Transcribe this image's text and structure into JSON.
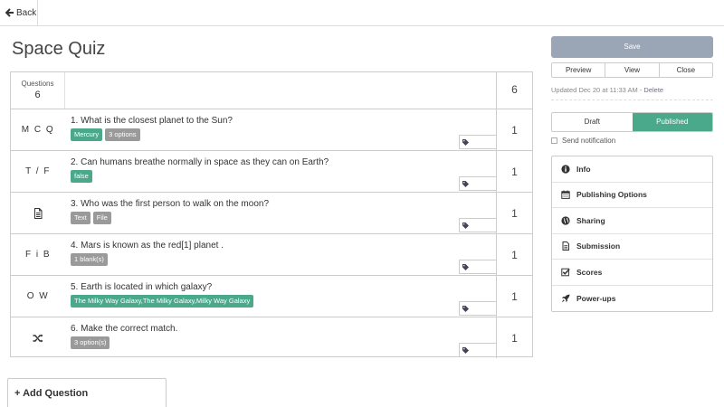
{
  "topbar": {
    "back_label": "Back"
  },
  "page": {
    "title": "Space Quiz"
  },
  "questions_header": {
    "label": "Questions",
    "count": "6",
    "total_points": "6"
  },
  "questions": [
    {
      "type_label": "M C Q",
      "type_icon": "",
      "text": "1. What is the closest planet to the Sun?",
      "tags": [
        {
          "text": "Mercury",
          "color": "green"
        },
        {
          "text": "3 options",
          "color": "gray"
        }
      ],
      "points": "1"
    },
    {
      "type_label": "T / F",
      "type_icon": "",
      "text": "2. Can humans breathe normally in space as they can on Earth?",
      "tags": [
        {
          "text": "false",
          "color": "green"
        }
      ],
      "points": "1"
    },
    {
      "type_label": "",
      "type_icon": "file-text-icon",
      "text": "3. Who was the first person to walk on the moon?",
      "tags": [
        {
          "text": "Text",
          "color": "gray"
        },
        {
          "text": "File",
          "color": "gray"
        }
      ],
      "points": "1"
    },
    {
      "type_label": "F i B",
      "type_icon": "",
      "text": "4. Mars is known as the red[1] planet .",
      "tags": [
        {
          "text": "1 blank(s)",
          "color": "gray"
        }
      ],
      "points": "1"
    },
    {
      "type_label": "O W",
      "type_icon": "",
      "text": "5. Earth is located in which galaxy?",
      "tags": [
        {
          "text": "The Milky Way Galaxy,The Milky Galaxy,Milky Way Galaxy",
          "color": "green"
        }
      ],
      "points": "1"
    },
    {
      "type_label": "",
      "type_icon": "shuffle-icon",
      "text": "6. Make the correct match.",
      "tags": [
        {
          "text": "3 option(s)",
          "color": "gray"
        }
      ],
      "points": "1"
    }
  ],
  "add_question": {
    "label": "Add Question"
  },
  "sidebar": {
    "save_label": "Save",
    "actions": {
      "preview": "Preview",
      "view": "View",
      "close": "Close"
    },
    "updated_text": "Updated Dec 20 at 11:33 AM - ",
    "delete_label": "Delete",
    "status": {
      "draft": "Draft",
      "published": "Published",
      "selected": "Published"
    },
    "notify_label": "Send notification",
    "menu": [
      {
        "label": "Info",
        "icon": "info-icon"
      },
      {
        "label": "Publishing Options",
        "icon": "calendar-icon"
      },
      {
        "label": "Sharing",
        "icon": "globe-icon"
      },
      {
        "label": "Submission",
        "icon": "file-icon"
      },
      {
        "label": "Scores",
        "icon": "checkbox-icon"
      },
      {
        "label": "Power-ups",
        "icon": "rocket-icon"
      }
    ]
  },
  "colors": {
    "accent_green": "#4aa88b",
    "tag_gray": "#9a9a9a",
    "save_button": "#9aa6b6"
  }
}
